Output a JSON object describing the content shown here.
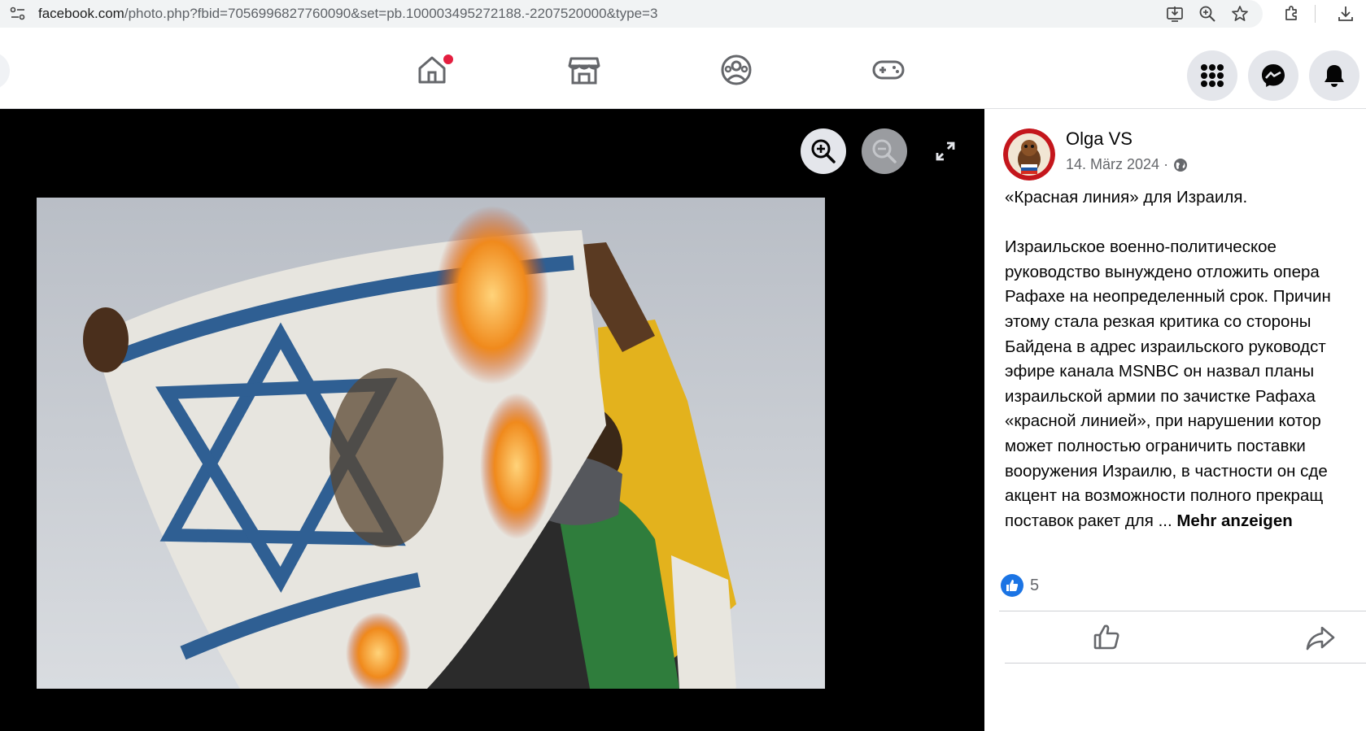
{
  "browser": {
    "url_host": "facebook.com",
    "url_rest": "/photo.php?fbid=7056996827760090&set=pb.100003495272188.-2207520000&type=3"
  },
  "nav": {
    "icons": [
      "home-icon",
      "marketplace-icon",
      "groups-icon",
      "gaming-icon"
    ],
    "right_buttons": [
      "menu-grid-icon",
      "messenger-icon",
      "notifications-icon"
    ]
  },
  "photo": {
    "description_icon": "image",
    "zoom_in_enabled": true,
    "zoom_out_enabled": false
  },
  "post": {
    "author": "Olga VS",
    "date": "14. März 2024 ·",
    "title_line": "«Красная линия» для Израиля.",
    "body_lines": [
      "Израильское военно-политическое",
      "руководство вынуждено отложить опера",
      "Рафахе на неопределенный срок. Причин",
      "этому стала резкая критика со стороны",
      "Байдена в адрес израильского руководст",
      "эфире канала MSNBC он назвал планы",
      "израильской армии по зачистке Рафаха",
      "«красной линией», при нарушении котор",
      "может полностью ограничить поставки",
      "вооружения Израилю, в частности он сде",
      "акцент на возможности полного прекращ"
    ],
    "last_line_start": "поставок ракет для ... ",
    "see_more": "Mehr anzeigen",
    "like_count": "5"
  },
  "colors": {
    "fb_blue": "#1b74e4",
    "notif_red": "#e41e3f",
    "viewer_bg": "#000000"
  }
}
